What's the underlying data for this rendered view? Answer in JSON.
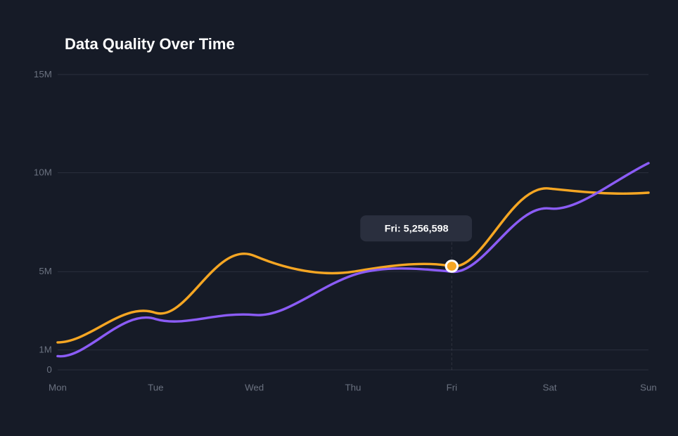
{
  "title": "Data Quality Over Time",
  "yAxis": {
    "labels": [
      "15M",
      "10M",
      "5M",
      "1M",
      "0"
    ],
    "values": [
      15000000,
      10000000,
      5000000,
      1000000,
      0
    ]
  },
  "xAxis": {
    "labels": [
      "Mon",
      "Tue",
      "Wed",
      "Thu",
      "Fri",
      "Sat",
      "Sun"
    ]
  },
  "tooltip": {
    "label": "Fri: 5,256,598"
  },
  "colors": {
    "orange": "#f5a623",
    "purple": "#8b5cf6",
    "grid": "#2a2f3e",
    "text": "#6b7280",
    "title": "#ffffff",
    "background": "#161b27",
    "tooltipBg": "#2a2f3e"
  },
  "series": {
    "orange": {
      "name": "orange-line",
      "points": [
        {
          "day": "Mon",
          "value": 1400000
        },
        {
          "day": "Tue",
          "value": 2900000
        },
        {
          "day": "Wed",
          "value": 5800000
        },
        {
          "day": "Thu",
          "value": 5000000
        },
        {
          "day": "Fri",
          "value": 5256598
        },
        {
          "day": "Sat",
          "value": 9200000
        },
        {
          "day": "Sun",
          "value": 9000000
        }
      ]
    },
    "purple": {
      "name": "purple-line",
      "points": [
        {
          "day": "Mon",
          "value": 700000
        },
        {
          "day": "Tue",
          "value": 2600000
        },
        {
          "day": "Wed",
          "value": 2800000
        },
        {
          "day": "Thu",
          "value": 4800000
        },
        {
          "day": "Fri",
          "value": 5000000
        },
        {
          "day": "Sat",
          "value": 8200000
        },
        {
          "day": "Sun",
          "value": 10500000
        }
      ]
    }
  }
}
